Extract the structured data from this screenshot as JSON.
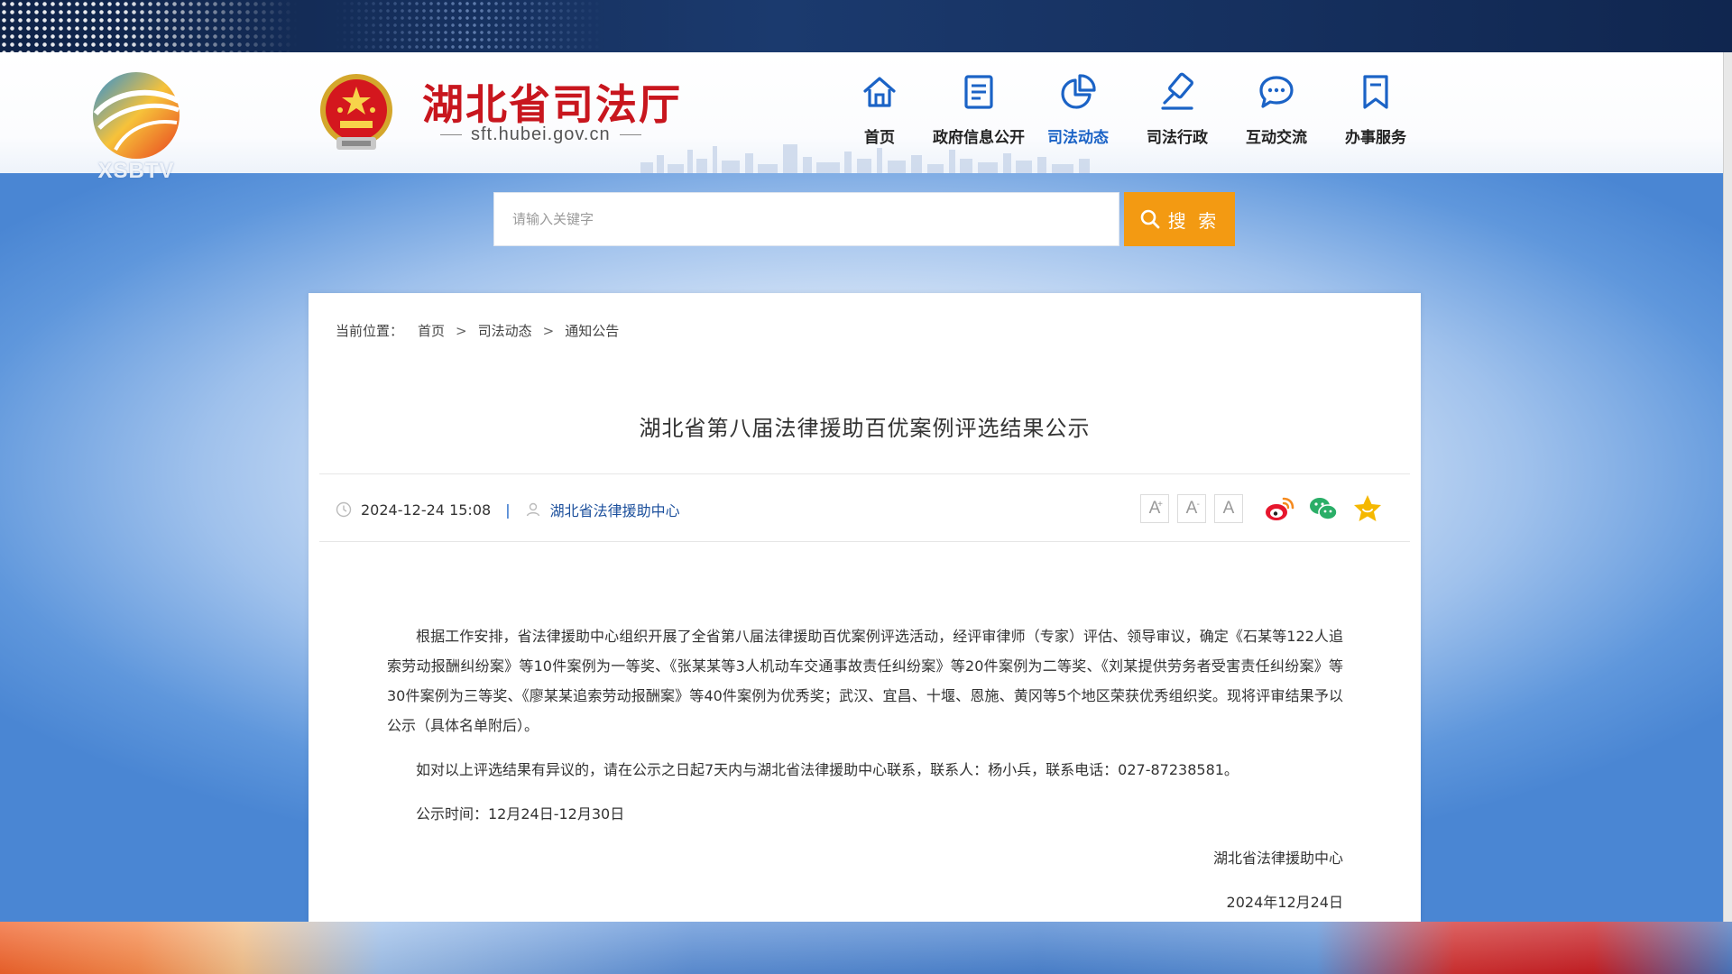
{
  "tv_logo": {
    "text": "XSBTV"
  },
  "header": {
    "site_name": "湖北省司法厅",
    "site_url": "sft.hubei.gov.cn",
    "nav": [
      {
        "label": "首页",
        "icon": "home-icon"
      },
      {
        "label": "政府信息公开",
        "icon": "document-list-icon"
      },
      {
        "label": "司法动态",
        "icon": "pie-chart-icon",
        "active": true
      },
      {
        "label": "司法行政",
        "icon": "gavel-icon"
      },
      {
        "label": "互动交流",
        "icon": "chat-bubble-icon"
      },
      {
        "label": "办事服务",
        "icon": "bookmark-icon"
      }
    ]
  },
  "search": {
    "placeholder": "请输入关键字",
    "button_label": "搜 索"
  },
  "breadcrumb": {
    "prefix": "当前位置：",
    "items": [
      "首页",
      "司法动态",
      "通知公告"
    ],
    "separator": ">"
  },
  "article": {
    "title": "湖北省第八届法律援助百优案例评选结果公示",
    "date": "2024-12-24 15:08",
    "source": "湖北省法律援助中心",
    "font_sizes": [
      "A",
      "A",
      "A"
    ],
    "paragraphs": [
      "根据工作安排，省法律援助中心组织开展了全省第八届法律援助百优案例评选活动，经评审律师（专家）评估、领导审议，确定《石某等122人追索劳动报酬纠纷案》等10件案例为一等奖、《张某某等3人机动车交通事故责任纠纷案》等20件案例为二等奖、《刘某提供劳务者受害责任纠纷案》等30件案例为三等奖、《廖某某追索劳动报酬案》等40件案例为优秀奖；武汉、宜昌、十堰、恩施、黄冈等5个地区荣获优秀组织奖。现将评审结果予以公示（具体名单附后）。",
      "如对以上评选结果有异议的，请在公示之日起7天内与湖北省法律援助中心联系，联系人：杨小兵，联系电话：027-87238581。",
      "公示时间：12月24日-12月30日"
    ],
    "signature": "湖北省法律援助中心",
    "sign_date": "2024年12月24日"
  },
  "colors": {
    "brand_red": "#c8161e",
    "nav_active": "#1b63c6",
    "search_button": "#f39a12",
    "weibo": "#e6162d",
    "wechat": "#2aae67",
    "favorite": "#f5b800"
  }
}
